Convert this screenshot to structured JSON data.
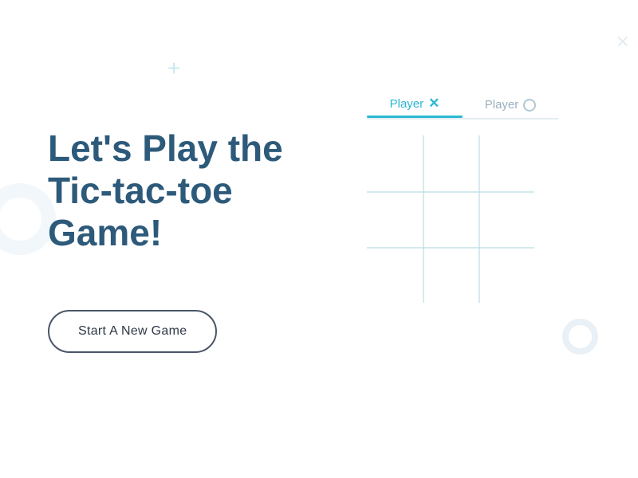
{
  "page": {
    "title": "Tic-tac-toe Game",
    "background_color": "#ffffff"
  },
  "decorations": {
    "plus_symbol": "+",
    "circle_color": "#d8e8f0",
    "x_symbol": "✕"
  },
  "left_panel": {
    "title_line1": "Let's Play the",
    "title_line2": "Tic-tac-toe",
    "title_line3": "Game!",
    "start_button_label": "Start A New Game"
  },
  "right_panel": {
    "player_x_tab_label": "Player",
    "player_x_symbol": "✕",
    "player_o_tab_label": "Player",
    "grid_cells": [
      "",
      "",
      "",
      "",
      "",
      "",
      "",
      "",
      ""
    ]
  },
  "colors": {
    "title_color": "#2d5a7a",
    "button_border": "#4a5568",
    "active_tab": "#2ab8d4",
    "inactive_tab": "#9ab0be",
    "grid_line": "#b0d8e2",
    "accent_blue": "#2ab8d4"
  }
}
